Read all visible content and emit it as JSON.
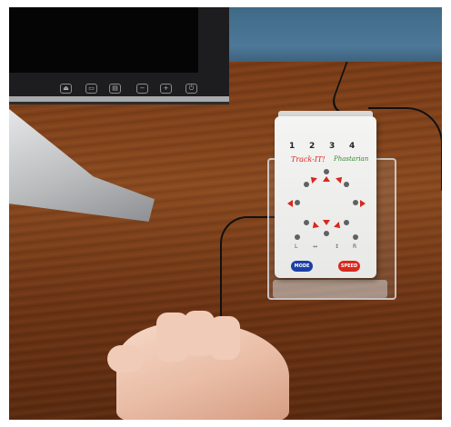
{
  "scene": {
    "description_free": true,
    "monitor_buttons": [
      "⏏",
      "▭",
      "▤",
      "−",
      "+",
      "⏻"
    ],
    "device": {
      "numbers": [
        "1",
        "2",
        "3",
        "4"
      ],
      "brand": "Track-IT!",
      "logo": "Phastarian",
      "bottom_labels": [
        "L",
        "↔",
        "↕",
        "R"
      ],
      "button_left": "MODE",
      "button_right": "SPEED",
      "colors": {
        "body": "#f2f2f0",
        "arrow": "#d8281e",
        "mode_button": "#1d3fa6",
        "speed_button": "#d8281e"
      }
    },
    "switch_color": "#e2bb40"
  }
}
